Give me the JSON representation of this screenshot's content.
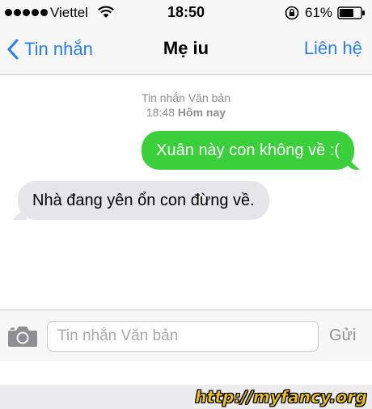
{
  "status_bar": {
    "carrier": "Viettel",
    "time": "18:50",
    "battery_percent": "61%",
    "icons": [
      "signal-dots-icon",
      "wifi-icon",
      "rotation-lock-icon",
      "battery-icon"
    ]
  },
  "nav": {
    "back_label": "Tin nhắn",
    "title": "Mẹ iu",
    "contact_label": "Liên hệ"
  },
  "conversation": {
    "header_line1": "Tin nhắn Văn bản",
    "header_time": "18:48",
    "header_day": "Hôm nay",
    "messages": [
      {
        "direction": "sent",
        "text": "Xuân này con không về :("
      },
      {
        "direction": "received",
        "text": "Nhà đang yên ổn con đừng về."
      }
    ]
  },
  "input_bar": {
    "placeholder": "Tin nhắn Văn bản",
    "send_label": "Gửi",
    "icons": [
      "camera-icon"
    ]
  },
  "watermark": "http://myfancy.org",
  "colors": {
    "accent_blue": "#2b7ff5",
    "sent_bubble": "#3ccf3c",
    "received_bubble": "#e5e5ea",
    "bar_background": "#f7f7f8"
  }
}
